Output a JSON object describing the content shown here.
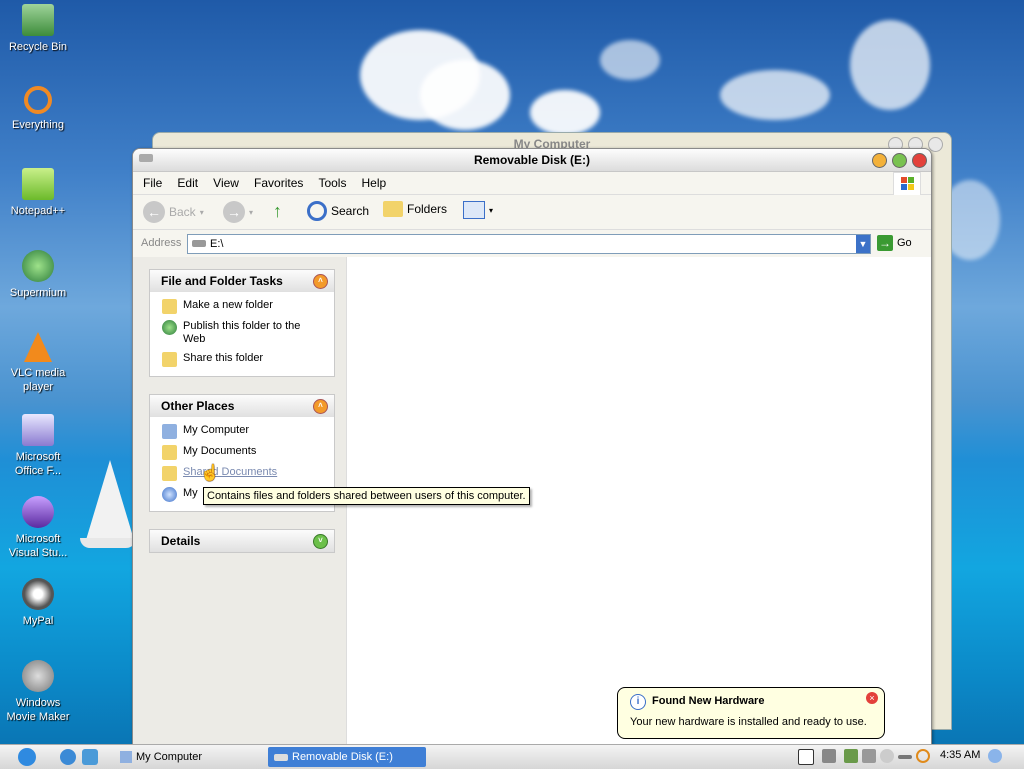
{
  "desktop": {
    "icons": [
      {
        "label": "Recycle Bin"
      },
      {
        "label": "Everything"
      },
      {
        "label": "Notepad++"
      },
      {
        "label": "Supermium"
      },
      {
        "label": "VLC media player"
      },
      {
        "label": "Microsoft Office F..."
      },
      {
        "label": "Microsoft Visual Stu..."
      },
      {
        "label": "MyPal"
      },
      {
        "label": "Windows Movie Maker"
      }
    ]
  },
  "background_window": {
    "title": "My Computer"
  },
  "window": {
    "title": "Removable Disk (E:)",
    "menu": [
      "File",
      "Edit",
      "View",
      "Favorites",
      "Tools",
      "Help"
    ],
    "toolbar": {
      "back": "Back",
      "search": "Search",
      "folders": "Folders"
    },
    "address": {
      "label": "Address",
      "value": "E:\\",
      "go": "Go"
    },
    "file_tasks": {
      "heading": "File and Folder Tasks",
      "items": [
        "Make a new folder",
        "Publish this folder to the Web",
        "Share this folder"
      ]
    },
    "other_places": {
      "heading": "Other Places",
      "items": [
        "My Computer",
        "My Documents",
        "Shared Documents",
        "My"
      ]
    },
    "details": {
      "heading": "Details"
    },
    "tooltip": "Contains files and folders shared between users of this computer."
  },
  "balloon": {
    "title": "Found New Hardware",
    "text": "Your new hardware is installed and ready to use."
  },
  "taskbar": {
    "tasks": [
      "My Computer",
      "Removable Disk (E:)"
    ],
    "clock": "4:35 AM"
  },
  "colors": {
    "active_task": "#3f7fd6",
    "orange_chevron": "#f39a2a",
    "link_blue": "#3b6fc8"
  }
}
